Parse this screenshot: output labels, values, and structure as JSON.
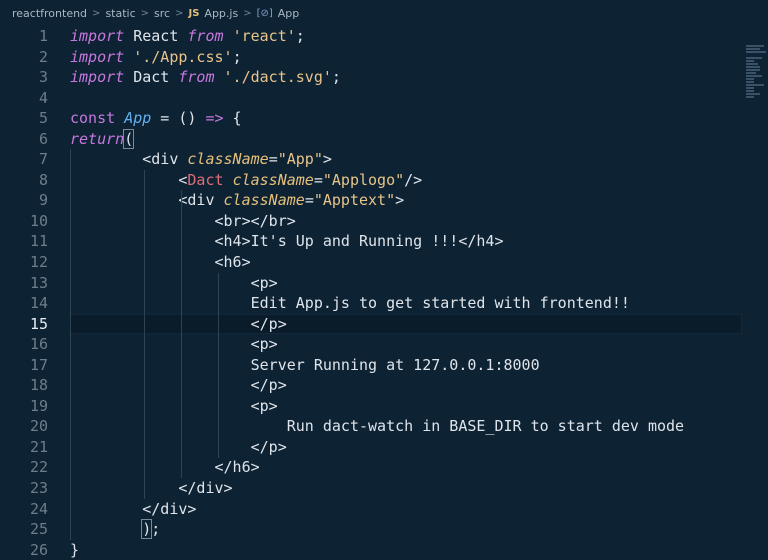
{
  "breadcrumb": {
    "parts": [
      "reactfrontend",
      "static",
      "src"
    ],
    "file_badge": "JS",
    "file": "App.js",
    "symbol_badge": "[⊘]",
    "symbol": "App",
    "separator": ">"
  },
  "editor": {
    "active_line": 15,
    "line_numbers": [
      "1",
      "2",
      "3",
      "4",
      "5",
      "6",
      "7",
      "8",
      "9",
      "10",
      "11",
      "12",
      "13",
      "14",
      "15",
      "16",
      "17",
      "18",
      "19",
      "20",
      "21",
      "22",
      "23",
      "24",
      "25",
      "26"
    ],
    "lines": [
      [
        {
          "t": "kw",
          "v": "import"
        },
        {
          "t": "txt",
          "v": " React "
        },
        {
          "t": "kw",
          "v": "from"
        },
        {
          "t": "txt",
          "v": " "
        },
        {
          "t": "str",
          "v": "'react'"
        },
        {
          "t": "txt",
          "v": ";"
        }
      ],
      [
        {
          "t": "kw",
          "v": "import"
        },
        {
          "t": "txt",
          "v": " "
        },
        {
          "t": "str",
          "v": "'./App.css'"
        },
        {
          "t": "txt",
          "v": ";"
        }
      ],
      [
        {
          "t": "kw",
          "v": "import"
        },
        {
          "t": "txt",
          "v": " Dact "
        },
        {
          "t": "kw",
          "v": "from"
        },
        {
          "t": "txt",
          "v": " "
        },
        {
          "t": "str",
          "v": "'./dact.svg'"
        },
        {
          "t": "txt",
          "v": ";"
        }
      ],
      [],
      [
        {
          "t": "kw2",
          "v": "const"
        },
        {
          "t": "txt",
          "v": " "
        },
        {
          "t": "fn",
          "v": "App"
        },
        {
          "t": "txt",
          "v": " = () "
        },
        {
          "t": "kw2",
          "v": "=>"
        },
        {
          "t": "txt",
          "v": " {"
        }
      ],
      [
        {
          "t": "kw",
          "v": "return"
        },
        {
          "t": "hl",
          "v": "("
        }
      ],
      [
        {
          "t": "txt",
          "v": "        <div "
        },
        {
          "t": "attr",
          "v": "className"
        },
        {
          "t": "txt",
          "v": "="
        },
        {
          "t": "str",
          "v": "\"App\""
        },
        {
          "t": "txt",
          "v": ">"
        }
      ],
      [
        {
          "t": "txt",
          "v": "            <"
        },
        {
          "t": "tag",
          "v": "Dact"
        },
        {
          "t": "txt",
          "v": " "
        },
        {
          "t": "attr",
          "v": "className"
        },
        {
          "t": "txt",
          "v": "="
        },
        {
          "t": "str",
          "v": "\"Applogo\""
        },
        {
          "t": "txt",
          "v": "/>"
        }
      ],
      [
        {
          "t": "txt",
          "v": "            <div "
        },
        {
          "t": "attr",
          "v": "className"
        },
        {
          "t": "txt",
          "v": "="
        },
        {
          "t": "str",
          "v": "\"Apptext\""
        },
        {
          "t": "txt",
          "v": ">"
        }
      ],
      [
        {
          "t": "txt",
          "v": "                <br></br>"
        }
      ],
      [
        {
          "t": "txt",
          "v": "                <h4>It's Up and Running !!!</h4>"
        }
      ],
      [
        {
          "t": "txt",
          "v": "                <h6>"
        }
      ],
      [
        {
          "t": "txt",
          "v": "                    <p>"
        }
      ],
      [
        {
          "t": "txt",
          "v": "                    Edit App.js to get started with frontend!!"
        }
      ],
      [
        {
          "t": "txt",
          "v": "                    </p>"
        }
      ],
      [
        {
          "t": "txt",
          "v": "                    <p>"
        }
      ],
      [
        {
          "t": "txt",
          "v": "                    Server Running at 127.0.0.1:8000"
        }
      ],
      [
        {
          "t": "txt",
          "v": "                    </p>"
        }
      ],
      [
        {
          "t": "txt",
          "v": "                    <p>"
        }
      ],
      [
        {
          "t": "txt",
          "v": "                        Run dact-watch in BASE_DIR to start dev mode"
        }
      ],
      [
        {
          "t": "txt",
          "v": "                    </p>"
        }
      ],
      [
        {
          "t": "txt",
          "v": "                </h6>"
        }
      ],
      [
        {
          "t": "txt",
          "v": "            </div>"
        }
      ],
      [
        {
          "t": "txt",
          "v": "        </div>"
        }
      ],
      [
        {
          "t": "txt",
          "v": "        "
        },
        {
          "t": "hl",
          "v": ")"
        },
        {
          "t": "txt",
          "v": ";"
        }
      ],
      [
        {
          "t": "txt",
          "v": "}"
        }
      ]
    ]
  },
  "colors": {
    "background": "#0d2233",
    "keyword": "#c678dd",
    "string": "#e8c48a",
    "tag": "#e06c75",
    "attribute": "#e5c07b",
    "function": "#61afef"
  }
}
